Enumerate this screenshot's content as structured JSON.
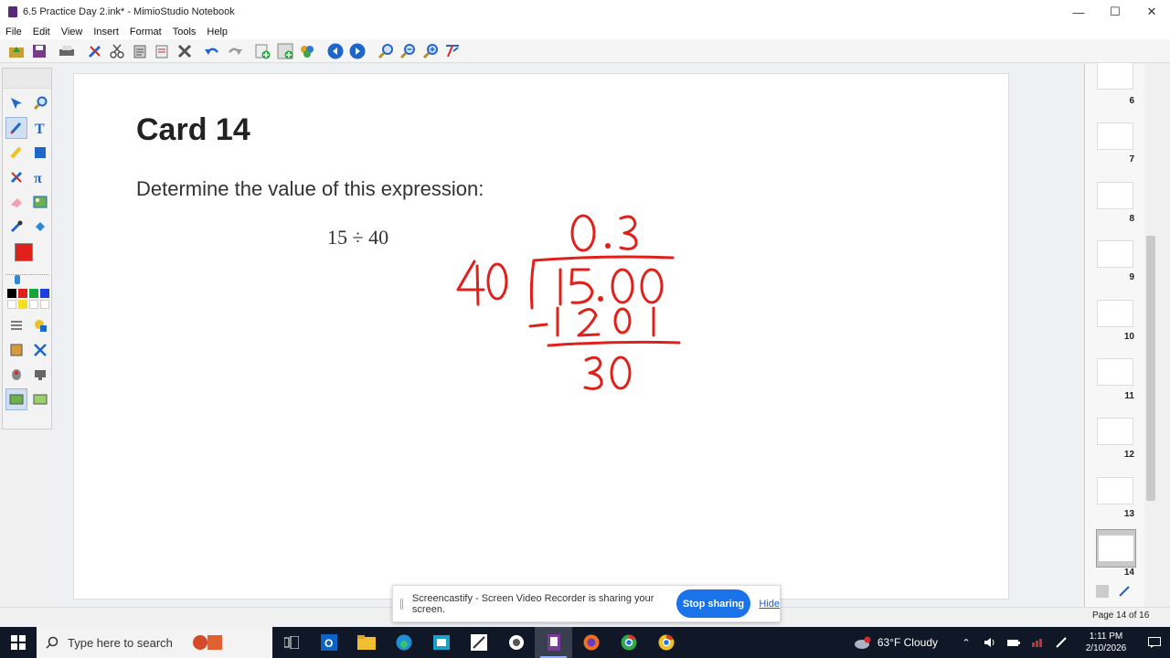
{
  "window": {
    "title": "6.5 Practice Day 2.ink* - MimioStudio Notebook",
    "controls": {
      "minimize": "—",
      "maximize": "☐",
      "close": "✕"
    }
  },
  "menu": [
    "File",
    "Edit",
    "View",
    "Insert",
    "Format",
    "Tools",
    "Help"
  ],
  "toolbar_icons": [
    "open-icon",
    "save-icon",
    "print-icon",
    "cut-marker-icon",
    "scissors-icon",
    "paste-icon",
    "delete-page-icon",
    "delete-icon",
    "undo-icon",
    "redo-icon",
    "add-page-icon",
    "add-object-icon",
    "gallery-icon",
    "previous-page-icon",
    "next-page-icon",
    "zoom-icon",
    "zoom-out-icon",
    "zoom-in-icon",
    "screen-tool-icon"
  ],
  "left_tools": [
    "select-icon",
    "zoom-tool-icon",
    "pen-icon",
    "text-icon",
    "highlighter-icon",
    "shape-icon",
    "eraser-marker-icon",
    "math-icon",
    "eraser-icon",
    "image-icon",
    "dropper-icon",
    "fill-icon"
  ],
  "colors": {
    "ink": "#e0201a",
    "swatches": [
      "#000000",
      "#e0201a",
      "#16a33a",
      "#1c3fe0",
      "#ffffff",
      "#f4e020",
      "#ffffff",
      "#ffffff"
    ]
  },
  "slide": {
    "title": "Card 14",
    "prompt": "Determine the value of this expression:",
    "expression": "15 ÷ 40"
  },
  "handwriting": {
    "quotient": "0.3",
    "divisor": "40",
    "dividend": "15.00",
    "subtract": "-120",
    "remainder": "30"
  },
  "thumbnails": [
    "6",
    "7",
    "8",
    "9",
    "10",
    "11",
    "12",
    "13",
    "14"
  ],
  "status": {
    "page": "Page 14 of 16"
  },
  "share_bar": {
    "text": "Screencastify - Screen Video Recorder is sharing your screen.",
    "stop_label": "Stop sharing",
    "hide_label": "Hide"
  },
  "taskbar": {
    "search_placeholder": "Type here to search",
    "weather": "63°F  Cloudy",
    "time": "1:11 PM",
    "date": "2/10/2026"
  }
}
